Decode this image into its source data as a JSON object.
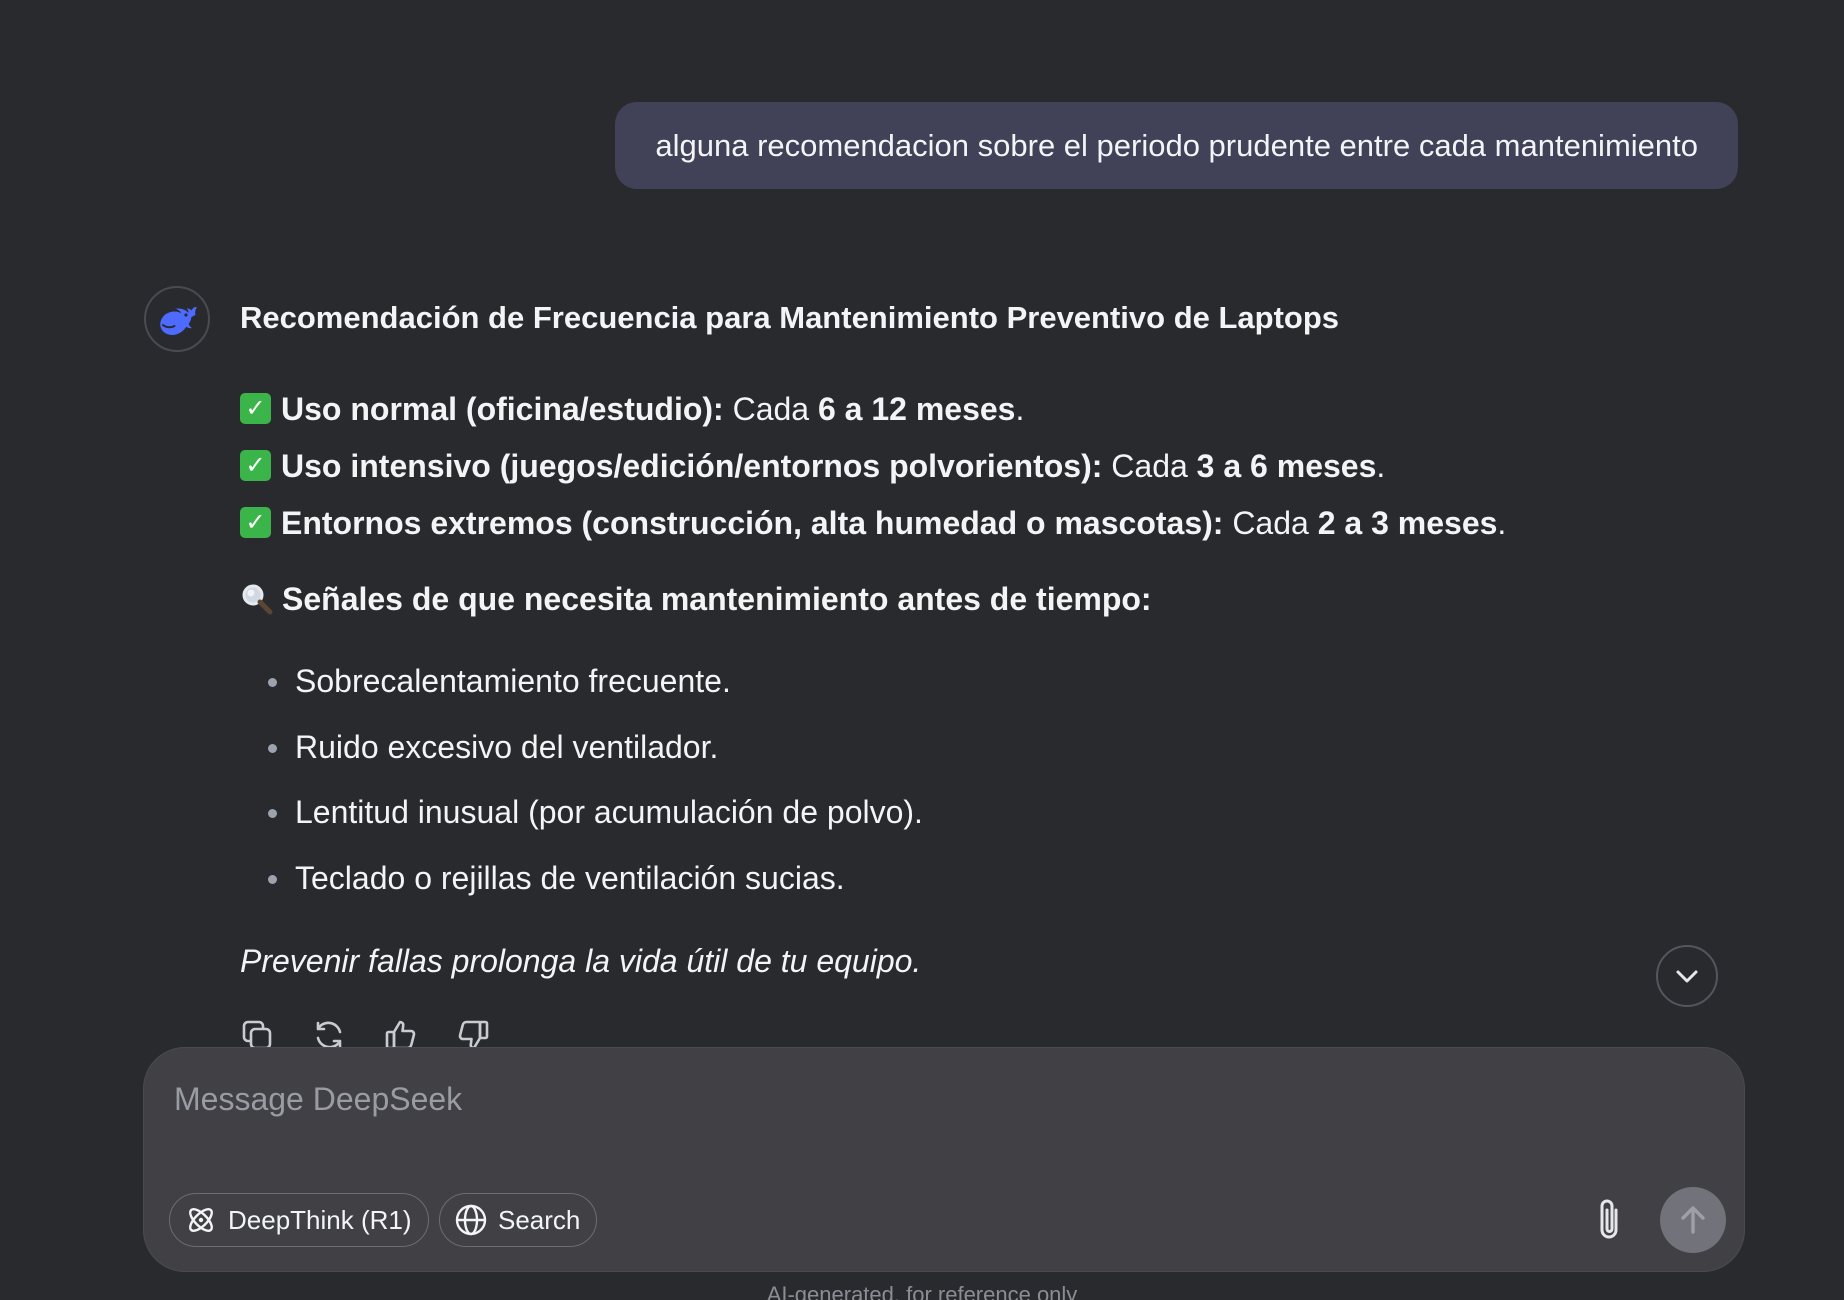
{
  "user_message": {
    "text": "alguna recomendacion sobre el periodo prudente entre cada mantenimiento"
  },
  "assistant": {
    "avatar_icon": "deepseek-whale-icon",
    "title": "Recomendación de Frecuencia para Mantenimiento Preventivo de Laptops",
    "frequency_items": [
      {
        "icon": "check-mark-icon",
        "label": "Uso normal (oficina/estudio):",
        "prefix": " Cada ",
        "value": "6 a 12 meses",
        "suffix": "."
      },
      {
        "icon": "check-mark-icon",
        "label": "Uso intensivo (juegos/edición/entornos polvorientos):",
        "prefix": " Cada ",
        "value": "3 a 6 meses",
        "suffix": "."
      },
      {
        "icon": "check-mark-icon",
        "label": "Entornos extremos (construcción, alta humedad o mascotas):",
        "prefix": " Cada ",
        "value": "2 a 3 meses",
        "suffix": "."
      }
    ],
    "signs_heading": {
      "icon": "magnifying-glass-icon",
      "text": "Señales de que necesita mantenimiento antes de tiempo:"
    },
    "signs": [
      "Sobrecalentamiento frecuente.",
      "Ruido excesivo del ventilador.",
      "Lentitud inusual (por acumulación de polvo).",
      "Teclado o rejillas de ventilación sucias."
    ],
    "closing": "Prevenir fallas prolonga la vida útil de tu equipo.",
    "actions": [
      "copy-icon",
      "regenerate-icon",
      "thumbs-up-icon",
      "thumbs-down-icon"
    ]
  },
  "scroll_button_icon": "chevron-down-icon",
  "composer": {
    "placeholder": "Message DeepSeek",
    "deepthink_label": "DeepThink (R1)",
    "search_label": "Search",
    "attach_icon": "paperclip-icon",
    "send_icon": "arrow-up-icon"
  },
  "disclaimer": "AI-generated, for reference only",
  "colors": {
    "background": "#292a2d",
    "user_bubble": "#414158",
    "composer": "#404045",
    "accent": "#4d6bfe",
    "check": "#3bb54a",
    "send_disabled": "#71727a"
  }
}
